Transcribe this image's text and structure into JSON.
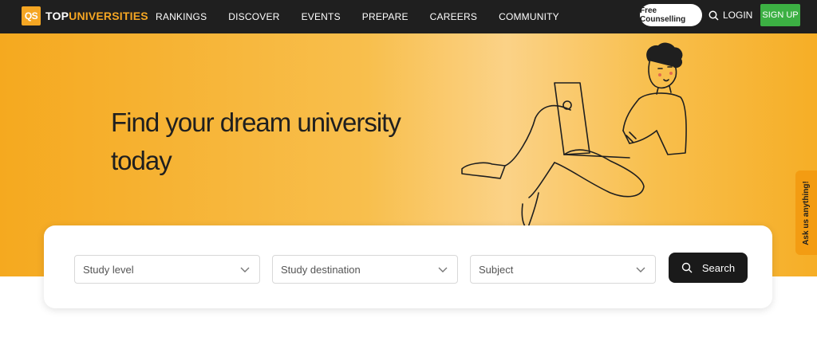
{
  "brand": {
    "logo_mark": "QS",
    "name_part1": "TOP",
    "name_part2": "UNIVERSITIES"
  },
  "nav": {
    "links": [
      "RANKINGS",
      "DISCOVER",
      "EVENTS",
      "PREPARE",
      "CAREERS",
      "COMMUNITY"
    ],
    "counselling_label": "Free Counselling",
    "login_label": "LOGIN",
    "signup_label": "SIGN UP"
  },
  "hero": {
    "title_line1": "Find your dream university",
    "title_line2": "today",
    "illustration_icon": "person-with-laptop-illustration"
  },
  "search": {
    "study_level_placeholder": "Study level",
    "destination_placeholder": "Study destination",
    "subject_placeholder": "Subject",
    "button_label": "Search"
  },
  "side_tab": {
    "label": "Ask us anything!"
  },
  "colors": {
    "nav_bg": "#1f1f1f",
    "accent_orange": "#f5a623",
    "signup_green": "#3cb043",
    "search_button": "#1a1a1a"
  }
}
